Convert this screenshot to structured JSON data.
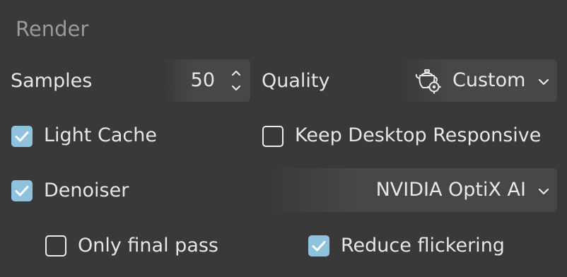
{
  "section": {
    "title": "Render"
  },
  "samples": {
    "label": "Samples",
    "value": "50"
  },
  "quality": {
    "label": "Quality",
    "selected": "Custom",
    "icon": "teapot-gear-icon"
  },
  "light_cache": {
    "label": "Light Cache",
    "checked": true
  },
  "keep_desktop_responsive": {
    "label": "Keep Desktop Responsive",
    "checked": false
  },
  "denoiser": {
    "label": "Denoiser",
    "checked": true,
    "selected": "NVIDIA OptiX AI"
  },
  "only_final_pass": {
    "label": "Only final pass",
    "checked": false
  },
  "reduce_flickering": {
    "label": "Reduce flickering",
    "checked": true
  },
  "colors": {
    "background": "#393939",
    "control_bg": "#474747",
    "checkbox_checked": "#8fc3dd",
    "title_text": "#9a9a9a",
    "text": "#e6e6e6"
  }
}
